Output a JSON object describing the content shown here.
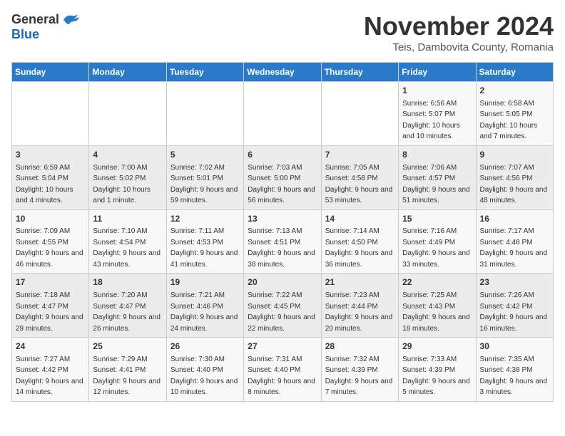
{
  "logo": {
    "general": "General",
    "blue": "Blue"
  },
  "header": {
    "month": "November 2024",
    "location": "Teis, Dambovita County, Romania"
  },
  "weekdays": [
    "Sunday",
    "Monday",
    "Tuesday",
    "Wednesday",
    "Thursday",
    "Friday",
    "Saturday"
  ],
  "weeks": [
    [
      {
        "day": "",
        "info": ""
      },
      {
        "day": "",
        "info": ""
      },
      {
        "day": "",
        "info": ""
      },
      {
        "day": "",
        "info": ""
      },
      {
        "day": "",
        "info": ""
      },
      {
        "day": "1",
        "info": "Sunrise: 6:56 AM\nSunset: 5:07 PM\nDaylight: 10 hours and 10 minutes."
      },
      {
        "day": "2",
        "info": "Sunrise: 6:58 AM\nSunset: 5:05 PM\nDaylight: 10 hours and 7 minutes."
      }
    ],
    [
      {
        "day": "3",
        "info": "Sunrise: 6:59 AM\nSunset: 5:04 PM\nDaylight: 10 hours and 4 minutes."
      },
      {
        "day": "4",
        "info": "Sunrise: 7:00 AM\nSunset: 5:02 PM\nDaylight: 10 hours and 1 minute."
      },
      {
        "day": "5",
        "info": "Sunrise: 7:02 AM\nSunset: 5:01 PM\nDaylight: 9 hours and 59 minutes."
      },
      {
        "day": "6",
        "info": "Sunrise: 7:03 AM\nSunset: 5:00 PM\nDaylight: 9 hours and 56 minutes."
      },
      {
        "day": "7",
        "info": "Sunrise: 7:05 AM\nSunset: 4:58 PM\nDaylight: 9 hours and 53 minutes."
      },
      {
        "day": "8",
        "info": "Sunrise: 7:06 AM\nSunset: 4:57 PM\nDaylight: 9 hours and 51 minutes."
      },
      {
        "day": "9",
        "info": "Sunrise: 7:07 AM\nSunset: 4:56 PM\nDaylight: 9 hours and 48 minutes."
      }
    ],
    [
      {
        "day": "10",
        "info": "Sunrise: 7:09 AM\nSunset: 4:55 PM\nDaylight: 9 hours and 46 minutes."
      },
      {
        "day": "11",
        "info": "Sunrise: 7:10 AM\nSunset: 4:54 PM\nDaylight: 9 hours and 43 minutes."
      },
      {
        "day": "12",
        "info": "Sunrise: 7:11 AM\nSunset: 4:53 PM\nDaylight: 9 hours and 41 minutes."
      },
      {
        "day": "13",
        "info": "Sunrise: 7:13 AM\nSunset: 4:51 PM\nDaylight: 9 hours and 38 minutes."
      },
      {
        "day": "14",
        "info": "Sunrise: 7:14 AM\nSunset: 4:50 PM\nDaylight: 9 hours and 36 minutes."
      },
      {
        "day": "15",
        "info": "Sunrise: 7:16 AM\nSunset: 4:49 PM\nDaylight: 9 hours and 33 minutes."
      },
      {
        "day": "16",
        "info": "Sunrise: 7:17 AM\nSunset: 4:48 PM\nDaylight: 9 hours and 31 minutes."
      }
    ],
    [
      {
        "day": "17",
        "info": "Sunrise: 7:18 AM\nSunset: 4:47 PM\nDaylight: 9 hours and 29 minutes."
      },
      {
        "day": "18",
        "info": "Sunrise: 7:20 AM\nSunset: 4:47 PM\nDaylight: 9 hours and 26 minutes."
      },
      {
        "day": "19",
        "info": "Sunrise: 7:21 AM\nSunset: 4:46 PM\nDaylight: 9 hours and 24 minutes."
      },
      {
        "day": "20",
        "info": "Sunrise: 7:22 AM\nSunset: 4:45 PM\nDaylight: 9 hours and 22 minutes."
      },
      {
        "day": "21",
        "info": "Sunrise: 7:23 AM\nSunset: 4:44 PM\nDaylight: 9 hours and 20 minutes."
      },
      {
        "day": "22",
        "info": "Sunrise: 7:25 AM\nSunset: 4:43 PM\nDaylight: 9 hours and 18 minutes."
      },
      {
        "day": "23",
        "info": "Sunrise: 7:26 AM\nSunset: 4:42 PM\nDaylight: 9 hours and 16 minutes."
      }
    ],
    [
      {
        "day": "24",
        "info": "Sunrise: 7:27 AM\nSunset: 4:42 PM\nDaylight: 9 hours and 14 minutes."
      },
      {
        "day": "25",
        "info": "Sunrise: 7:29 AM\nSunset: 4:41 PM\nDaylight: 9 hours and 12 minutes."
      },
      {
        "day": "26",
        "info": "Sunrise: 7:30 AM\nSunset: 4:40 PM\nDaylight: 9 hours and 10 minutes."
      },
      {
        "day": "27",
        "info": "Sunrise: 7:31 AM\nSunset: 4:40 PM\nDaylight: 9 hours and 8 minutes."
      },
      {
        "day": "28",
        "info": "Sunrise: 7:32 AM\nSunset: 4:39 PM\nDaylight: 9 hours and 7 minutes."
      },
      {
        "day": "29",
        "info": "Sunrise: 7:33 AM\nSunset: 4:39 PM\nDaylight: 9 hours and 5 minutes."
      },
      {
        "day": "30",
        "info": "Sunrise: 7:35 AM\nSunset: 4:38 PM\nDaylight: 9 hours and 3 minutes."
      }
    ]
  ]
}
